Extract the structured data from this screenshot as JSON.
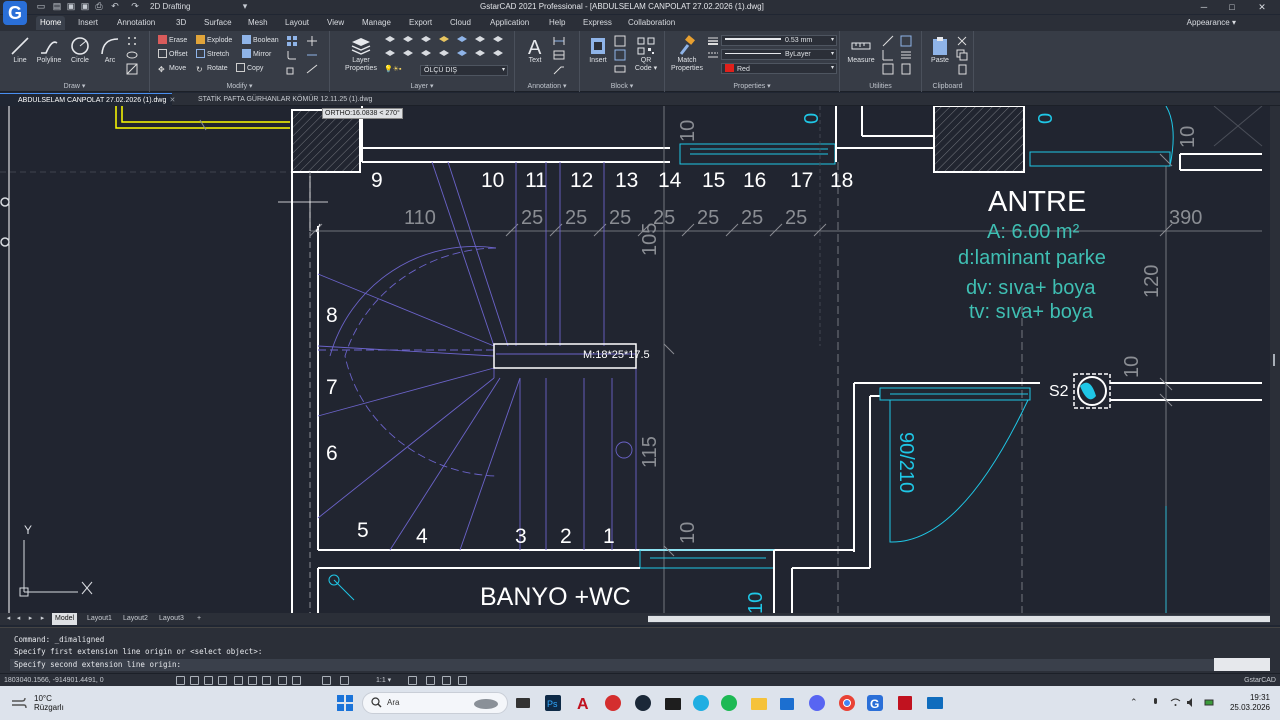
{
  "titlebar": {
    "logo_letter": "G",
    "workspace": "2D Drafting",
    "title": "GstarCAD 2021 Professional - [ABDULSELAM CANPOLAT 27.02.2026 (1).dwg]",
    "minimize": "─",
    "maximize": "□",
    "close": "✕"
  },
  "menu": {
    "tabs": [
      "Home",
      "Insert",
      "Annotation",
      "3D",
      "Surface",
      "Mesh",
      "Layout",
      "View",
      "Manage",
      "Export",
      "Cloud",
      "Application",
      "Help",
      "Express",
      "Collaboration"
    ],
    "active": "Home",
    "appearance": "Appearance ▾"
  },
  "ribbon": {
    "draw": {
      "title": "Draw ▾",
      "line": "Line",
      "polyline": "Polyline",
      "circle": "Circle",
      "arc": "Arc"
    },
    "modify": {
      "title": "Modify ▾",
      "erase": "Erase",
      "explode": "Explode",
      "boolean": "Boolean",
      "offset": "Offset",
      "stretch": "Stretch",
      "mirror": "Mirror",
      "move": "Move",
      "rotate": "Rotate",
      "copy": "Copy"
    },
    "layer": {
      "title": "Layer ▾",
      "layer_properties_1": "Layer",
      "layer_properties_2": "Properties",
      "current_layer": "ÖLÇÜ DIŞ"
    },
    "annotation": {
      "title": "Annotation ▾",
      "text": "Text"
    },
    "block": {
      "title": "Block ▾",
      "insert": "Insert",
      "qr_1": "QR",
      "qr_2": "Code ▾"
    },
    "properties": {
      "title": "Properties ▾",
      "match_1": "Match",
      "match_2": "Properties",
      "lineweight": "0.53 mm",
      "linetype": "ByLayer",
      "color": "Red",
      "color_hex": "#e0201b"
    },
    "utilities": {
      "title": "Utilities",
      "measure": "Measure"
    },
    "clipboard": {
      "title": "Clipboard",
      "paste": "Paste"
    }
  },
  "doc_tabs": [
    {
      "label": "ABDULSELAM CANPOLAT 27.02.2026 (1).dwg",
      "active": true
    },
    {
      "label": "STATİK PAFTA GÜRHANLAR KÖMÜR 12.11.25 (1).dwg",
      "active": false
    }
  ],
  "drawing": {
    "ortho_tooltip": "ORTHO:16.0838 < 270°",
    "step_numbers_top": [
      "9",
      "10",
      "11",
      "12",
      "13",
      "14",
      "15",
      "16",
      "17",
      "18"
    ],
    "step_numbers_left": [
      "8",
      "7",
      "6",
      "5"
    ],
    "step_numbers_bottom": [
      "4",
      "3",
      "2",
      "1"
    ],
    "dims_25": [
      "25",
      "25",
      "25",
      "25",
      "25",
      "25",
      "25"
    ],
    "dim_110": "110",
    "dim_105": "105",
    "dim_115": "115",
    "dim_10_a": "10",
    "dim_10_b": "10",
    "dim_10_c": "10",
    "dim_10_d": "10",
    "dim_0_a": "0",
    "dim_0_b": "0",
    "dim_390": "390",
    "dim_120": "120",
    "stair_label": "M:18*25*17.5",
    "room_name": "ANTRE",
    "room_area": "A: 6.00 m²",
    "floor": "d:laminant parke",
    "wall": "dv: sıva+ boya",
    "ceiling": "tv: sıva+ boya",
    "door": "90/210",
    "window_tag": "S2",
    "bathroom": "BANYO +WC",
    "ucs_y": "Y",
    "colors": {
      "background": "#212530",
      "wall": "#ffffff",
      "dimension": "#8a8d93",
      "stair": "#6b63c9",
      "room_text": "#3fbfb3",
      "hatch": "#ffff00",
      "accent_cyan": "#1fc7e6"
    }
  },
  "layout_tabs": [
    "Model",
    "Layout1",
    "Layout2",
    "Layout3",
    "+"
  ],
  "command_lines": [
    "Command: _dimaligned",
    "Specify first extension line origin or <select object>:",
    "Specify second extension line origin:"
  ],
  "status": {
    "coordinates": "1803040.1566, -914901.4491, 0",
    "scale": "1:1 ▾",
    "brand": "GstarCAD"
  },
  "taskbar": {
    "temperature": "10°C",
    "weather": "Rüzgarlı",
    "search": "Ara",
    "time": "19:31",
    "date": "25.03.2026"
  }
}
